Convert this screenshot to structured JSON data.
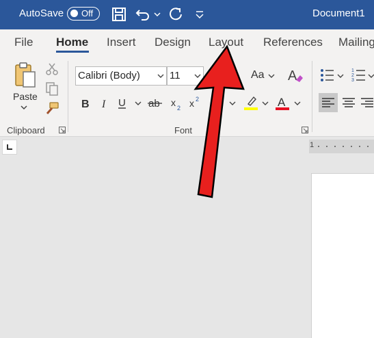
{
  "titlebar": {
    "autosave_label": "AutoSave",
    "toggle_state": "Off",
    "document_name": "Document1",
    "bg_color": "#2b579a"
  },
  "tabs": [
    {
      "label": "File"
    },
    {
      "label": "Home",
      "active": true
    },
    {
      "label": "Insert"
    },
    {
      "label": "Design"
    },
    {
      "label": "Layout"
    },
    {
      "label": "References"
    },
    {
      "label": "Mailing"
    }
  ],
  "clipboard": {
    "group_label": "Clipboard",
    "paste_label": "Paste"
  },
  "font": {
    "group_label": "Font",
    "font_name": "Calibri (Body)",
    "font_size": "11",
    "change_case_label": "Aa",
    "highlight_color": "#ffff00",
    "font_color": "#e81123"
  },
  "ruler": {
    "start_number": "1"
  },
  "annotation": {
    "arrow_color": "#e8201e"
  }
}
